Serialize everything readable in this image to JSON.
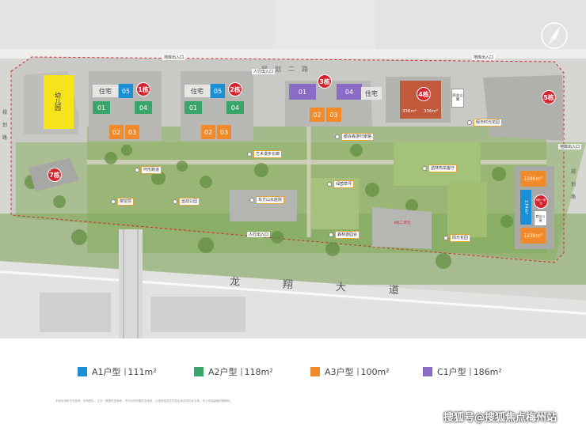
{
  "roads": {
    "top": "规划二路",
    "bottom": "龙翔大道",
    "left": "规划路",
    "right": "规划路"
  },
  "gates": {
    "top_left": "地库出入口",
    "top_center": "人行出入口",
    "top_right": "地库出入口",
    "bottom": "人行出入口",
    "right": "地库出入口"
  },
  "buildings": {
    "b1": "1栋",
    "b2": "2栋",
    "b3": "3栋",
    "b4": "4栋",
    "b5": "5栋",
    "b7": "7栋"
  },
  "units": {
    "zhuzhai": "住宅",
    "u01": "01",
    "u02": "02",
    "u03": "03",
    "u04": "04",
    "u05": "05"
  },
  "kindergarten": "幼儿园",
  "b4_units": {
    "area_left": "336m²",
    "area_right": "336m²",
    "side_label": "商业公寓"
  },
  "b6": {
    "top": "1286m²",
    "mid": "174m²",
    "bottom": "1238m²",
    "tag": "6栋一单元",
    "side": "商业公寓"
  },
  "b8": {
    "label": "8栋二单元"
  },
  "pois": {
    "p1": "环形跑道",
    "p2": "架空层",
    "p3": "运动公园",
    "p4": "艺术漫步长廊",
    "p5": "东方山水庭院",
    "p6": "都会森游归家路",
    "p7": "绿茵草坪",
    "p8": "森林游园会",
    "p9": "假日时光花园",
    "p10": "遗林热岛客厅",
    "p11": "阳光花园"
  },
  "legend": [
    {
      "label": "A1户型",
      "area": "111m²",
      "color": "#1a8fd6"
    },
    {
      "label": "A2户型",
      "area": "118m²",
      "color": "#3aa56a"
    },
    {
      "label": "A3户型",
      "area": "100m²",
      "color": "#f08a2b"
    },
    {
      "label": "C1户型",
      "area": "186m²",
      "color": "#8a6cc8"
    }
  ],
  "disclaimer": "本宣传资料仅为参考，所有图片、文字、数据仅供参考，不作为任何要约及承诺，以政府批准文件及买卖合同约定为准。本公司保留最终解释权。",
  "watermark": "搜狐号@搜狐焦点梅州站",
  "colors": {
    "a1": "#1a8fd6",
    "a2": "#3aa56a",
    "a3": "#f08a2b",
    "c1": "#8a6cc8",
    "building_marker": "#d5232f",
    "kindergarten": "#f5e31b"
  }
}
